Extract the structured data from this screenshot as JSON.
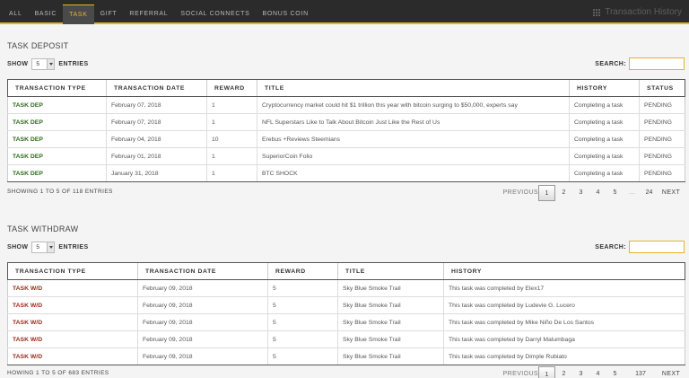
{
  "nav": {
    "tabs": [
      "ALL",
      "BASIC",
      "TASK",
      "GIFT",
      "REFERRAL",
      "SOCIAL CONNECTS",
      "BONUS COIN"
    ],
    "active_tab": "TASK",
    "history_link": "Transaction History"
  },
  "deposit": {
    "title": "TASK DEPOSIT",
    "show_label": "SHOW",
    "entries_value": "5",
    "entries_label": "ENTRIES",
    "search_label": "SEARCH:",
    "columns": [
      "TRANSACTION TYPE",
      "TRANSACTION DATE",
      "REWARD",
      "TITLE",
      "HISTORY",
      "STATUS"
    ],
    "rows": [
      [
        "TASK DEP",
        "February 07, 2018",
        "1",
        "Cryptocurrency market could hit $1 trillion this year with bitcoin surging to $50,000, experts say",
        "Completing a task",
        "PENDING"
      ],
      [
        "TASK DEP",
        "February 07, 2018",
        "1",
        "NFL Superstars Like to Talk About Bitcoin Just Like the Rest of Us",
        "Completing a task",
        "PENDING"
      ],
      [
        "TASK DEP",
        "February 04, 2018",
        "10",
        "Erebus +Reviews Steemians",
        "Completing a task",
        "PENDING"
      ],
      [
        "TASK DEP",
        "February 01, 2018",
        "1",
        "SuperiorCoin Folio",
        "Completing a task",
        "PENDING"
      ],
      [
        "TASK DEP",
        "January 31, 2018",
        "1",
        "BTC SHOCK",
        "Completing a task",
        "PENDING"
      ]
    ],
    "info": "SHOWING 1 TO 5 OF 118 ENTRIES",
    "pager": {
      "prev": "PREVIOUS",
      "pages": [
        "1",
        "2",
        "3",
        "4",
        "5",
        "…",
        "24"
      ],
      "active": "1",
      "next": "NEXT"
    }
  },
  "withdraw": {
    "title": "TASK WITHDRAW",
    "show_label": "SHOW",
    "entries_value": "5",
    "entries_label": "ENTRIES",
    "search_label": "SEARCH:",
    "columns": [
      "TRANSACTION TYPE",
      "TRANSACTION DATE",
      "REWARD",
      "TITLE",
      "HISTORY"
    ],
    "rows": [
      [
        "TASK W/D",
        "February 09, 2018",
        "5",
        "Sky Blue Smoke Trail",
        "This task was completed by Elex17"
      ],
      [
        "TASK W/D",
        "February 09, 2018",
        "5",
        "Sky Blue Smoke Trail",
        "This task was completed by Ludevie G. Lucero"
      ],
      [
        "TASK W/D",
        "February 09, 2018",
        "5",
        "Sky Blue Smoke Trail",
        "This task was completed by Mike Niño De Los Santos"
      ],
      [
        "TASK W/D",
        "February 09, 2018",
        "5",
        "Sky Blue Smoke Trail",
        "This task was completed by Darryl Malumbaga"
      ],
      [
        "TASK W/D",
        "February 09, 2018",
        "5",
        "Sky Blue Smoke Trail",
        "This task was completed by Dimple Rubiato"
      ]
    ],
    "info": "HOWING 1 TO 5 OF 683 ENTRIES",
    "pager": {
      "prev": "PREVIOUS",
      "pages": [
        "1",
        "2",
        "3",
        "4",
        "5",
        "137"
      ],
      "active": "1",
      "next": "NEXT"
    }
  },
  "colors": {
    "accent": "#e6b422",
    "deposit_type": "#2e6b1e",
    "withdraw_type": "#9b2a1c",
    "nav_bg": "#2b2b2b"
  }
}
